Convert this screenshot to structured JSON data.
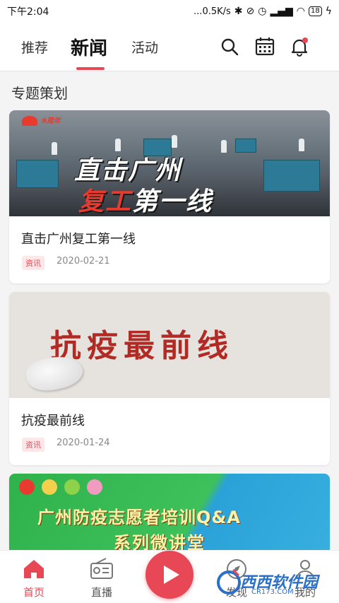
{
  "status_bar": {
    "time": "下午2:04",
    "network_speed": "...0.5K/s",
    "battery": "18"
  },
  "top_nav": {
    "tabs": [
      {
        "label": "推荐",
        "active": false
      },
      {
        "label": "新闻",
        "active": true
      },
      {
        "label": "活动",
        "active": false
      }
    ],
    "icons": [
      "search-icon",
      "calendar-icon",
      "bell-icon"
    ],
    "accent_color": "#e84855"
  },
  "section": {
    "title": "专题策划"
  },
  "cards": [
    {
      "banner_line1": "直击广州",
      "banner_line2_red": "复工",
      "banner_line2_white": "第一线",
      "banner_logo_text": "9周年",
      "title": "直击广州复工第一线",
      "badge": "资讯",
      "date": "2020-02-21"
    },
    {
      "banner_text": "抗疫最前线",
      "title": "抗疫最前线",
      "badge": "资讯",
      "date": "2020-01-24"
    },
    {
      "banner_line1": "广州防疫志愿者培训Q&A",
      "banner_line2": "系列微讲堂"
    }
  ],
  "bottom_nav": {
    "items": [
      {
        "label": "首页",
        "icon": "home-icon",
        "active": true
      },
      {
        "label": "直播",
        "icon": "radio-icon",
        "active": false
      },
      {
        "label": "",
        "icon": "play-icon",
        "active": false
      },
      {
        "label": "发现",
        "icon": "discover-icon",
        "active": false
      },
      {
        "label": "我的",
        "icon": "profile-icon",
        "active": false
      }
    ]
  },
  "watermark": {
    "text": "西西软件园",
    "sub": "CR173.COM"
  }
}
